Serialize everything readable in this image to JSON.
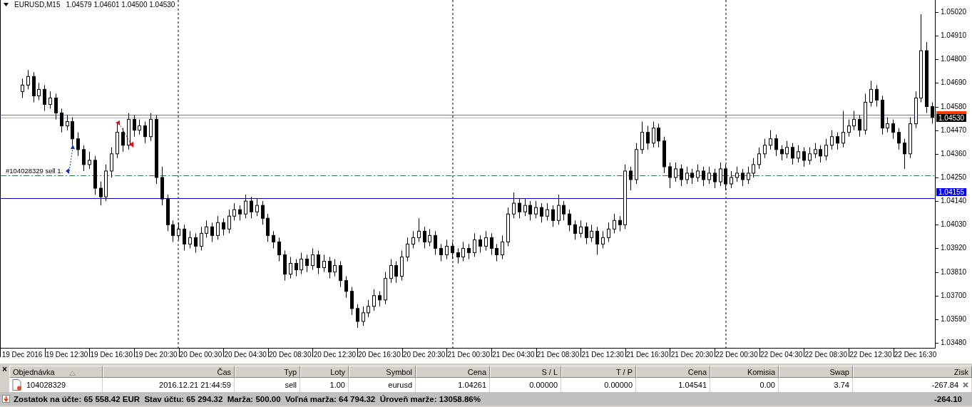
{
  "chart": {
    "symbol": "EURUSD,M15",
    "ohlc": "1.04579 1.04601 1.04500 1.04530",
    "order_label": "#104028329 sell 1.",
    "price_badges": [
      {
        "text": "1.04530",
        "color": "#000000"
      },
      {
        "text": "1.04155",
        "color": "#0000ff"
      }
    ],
    "chart_data": {
      "type": "candlestick",
      "categories": [
        "19 Dec 2016",
        null,
        null,
        null,
        null,
        null,
        null,
        null,
        "19 Dec 12:30",
        null,
        null,
        null,
        null,
        null,
        null,
        null,
        "19 Dec 16:30",
        null,
        null,
        null,
        null,
        null,
        null,
        null,
        "19 Dec 20:30",
        null,
        null,
        null,
        null,
        null,
        null,
        null,
        "20 Dec 00:30",
        null,
        null,
        null,
        null,
        null,
        null,
        null,
        "20 Dec 04:30",
        null,
        null,
        null,
        null,
        null,
        null,
        null,
        "20 Dec 08:30",
        null,
        null,
        null,
        null,
        null,
        null,
        null,
        "20 Dec 12:30",
        null,
        null,
        null,
        null,
        null,
        null,
        null,
        "20 Dec 16:30",
        null,
        null,
        null,
        null,
        null,
        null,
        null,
        "20 Dec 20:30",
        null,
        null,
        null,
        null,
        null,
        null,
        null,
        "21 Dec 00:30",
        null,
        null,
        null,
        null,
        null,
        null,
        null,
        "21 Dec 04:30",
        null,
        null,
        null,
        null,
        null,
        null,
        null,
        "21 Dec 08:30",
        null,
        null,
        null,
        null,
        null,
        null,
        null,
        "21 Dec 12:30",
        null,
        null,
        null,
        null,
        null,
        null,
        null,
        "21 Dec 16:30",
        null,
        null,
        null,
        null,
        null,
        null,
        null,
        "21 Dec 20:30",
        null,
        null,
        null,
        null,
        null,
        null,
        null,
        "22 Dec 00:30",
        null,
        null,
        null,
        null,
        null,
        null,
        null,
        "22 Dec 04:30",
        null,
        null,
        null,
        null,
        null,
        null,
        null,
        "22 Dec 08:30",
        null,
        null,
        null,
        null,
        null,
        null,
        null,
        "22 Dec 12:30",
        null,
        null,
        null,
        null,
        null,
        null,
        null,
        "22 Dec 16:30",
        null,
        null,
        null
      ],
      "ylim": [
        1.03457,
        1.05076
      ],
      "ref_lines": [
        {
          "axis": "y",
          "value": 1.04541,
          "color": "#e05a20"
        },
        {
          "axis": "y",
          "value": 1.0453,
          "color": "#b8b8b8"
        },
        {
          "axis": "y",
          "value": 1.04261,
          "color": "#2e7d32"
        },
        {
          "axis": "y",
          "value": 1.04155,
          "color": "#0000b0"
        }
      ],
      "ohlc": [
        [
          1.0465,
          1.0471,
          1.0462,
          1.0468
        ],
        [
          1.0468,
          1.0475,
          1.0466,
          1.0472
        ],
        [
          1.0472,
          1.0474,
          1.046,
          1.0463
        ],
        [
          1.0463,
          1.0469,
          1.0461,
          1.0466
        ],
        [
          1.0466,
          1.0468,
          1.0456,
          1.0459
        ],
        [
          1.0459,
          1.0465,
          1.0457,
          1.0462
        ],
        [
          1.0462,
          1.0464,
          1.0452,
          1.0455
        ],
        [
          1.0455,
          1.0457,
          1.0446,
          1.0449
        ],
        [
          1.0449,
          1.0454,
          1.0447,
          1.0451
        ],
        [
          1.0451,
          1.0453,
          1.044,
          1.0443
        ],
        [
          1.0443,
          1.0446,
          1.0435,
          1.0438
        ],
        [
          1.0438,
          1.044,
          1.0428,
          1.0431
        ],
        [
          1.0431,
          1.0437,
          1.0429,
          1.0433
        ],
        [
          1.0433,
          1.0435,
          1.0417,
          1.042
        ],
        [
          1.042,
          1.0423,
          1.0412,
          1.0416
        ],
        [
          1.0416,
          1.0431,
          1.0414,
          1.0428
        ],
        [
          1.0428,
          1.0439,
          1.0425,
          1.0436
        ],
        [
          1.0436,
          1.045,
          1.0434,
          1.0446
        ],
        [
          1.0446,
          1.0448,
          1.0437,
          1.044
        ],
        [
          1.044,
          1.0455,
          1.0438,
          1.0452
        ],
        [
          1.0452,
          1.0454,
          1.0444,
          1.0447
        ],
        [
          1.0447,
          1.0452,
          1.0445,
          1.0449
        ],
        [
          1.0449,
          1.0451,
          1.0441,
          1.0444
        ],
        [
          1.0444,
          1.0455,
          1.0442,
          1.0452
        ],
        [
          1.0452,
          1.0454,
          1.0422,
          1.0425
        ],
        [
          1.0425,
          1.043,
          1.0412,
          1.0415
        ],
        [
          1.0415,
          1.0417,
          1.04,
          1.0403
        ],
        [
          1.0403,
          1.0405,
          1.0395,
          1.0398
        ],
        [
          1.0398,
          1.0404,
          1.0396,
          1.0401
        ],
        [
          1.0401,
          1.0403,
          1.0391,
          1.0394
        ],
        [
          1.0394,
          1.04,
          1.0392,
          1.0397
        ],
        [
          1.0397,
          1.0399,
          1.039,
          1.0393
        ],
        [
          1.0393,
          1.0402,
          1.0391,
          1.0399
        ],
        [
          1.0399,
          1.0405,
          1.0397,
          1.0402
        ],
        [
          1.0402,
          1.0404,
          1.0395,
          1.0398
        ],
        [
          1.0398,
          1.0407,
          1.0396,
          1.0404
        ],
        [
          1.0404,
          1.0406,
          1.0398,
          1.0401
        ],
        [
          1.0401,
          1.041,
          1.0399,
          1.0407
        ],
        [
          1.0407,
          1.0413,
          1.0405,
          1.041
        ],
        [
          1.041,
          1.0412,
          1.0405,
          1.0408
        ],
        [
          1.0408,
          1.0417,
          1.0406,
          1.0414
        ],
        [
          1.0414,
          1.0416,
          1.0406,
          1.0409
        ],
        [
          1.0409,
          1.0415,
          1.0407,
          1.0412
        ],
        [
          1.0412,
          1.0414,
          1.0403,
          1.0406
        ],
        [
          1.0406,
          1.0408,
          1.0395,
          1.0398
        ],
        [
          1.0398,
          1.04,
          1.0392,
          1.0395
        ],
        [
          1.0395,
          1.0397,
          1.0386,
          1.0389
        ],
        [
          1.0389,
          1.0391,
          1.0377,
          1.038
        ],
        [
          1.038,
          1.0388,
          1.0378,
          1.0385
        ],
        [
          1.0385,
          1.0387,
          1.0379,
          1.0382
        ],
        [
          1.0382,
          1.039,
          1.038,
          1.0387
        ],
        [
          1.0387,
          1.0389,
          1.0381,
          1.0384
        ],
        [
          1.0384,
          1.0392,
          1.0382,
          1.0389
        ],
        [
          1.0389,
          1.0391,
          1.038,
          1.0383
        ],
        [
          1.0383,
          1.0389,
          1.0381,
          1.0386
        ],
        [
          1.0386,
          1.0388,
          1.0378,
          1.0381
        ],
        [
          1.0381,
          1.0387,
          1.0379,
          1.0384
        ],
        [
          1.0384,
          1.0386,
          1.0374,
          1.0377
        ],
        [
          1.0377,
          1.0379,
          1.0369,
          1.0372
        ],
        [
          1.0372,
          1.0374,
          1.0361,
          1.0364
        ],
        [
          1.0364,
          1.0366,
          1.0355,
          1.0358
        ],
        [
          1.0358,
          1.0365,
          1.0356,
          1.0362
        ],
        [
          1.0362,
          1.0368,
          1.036,
          1.0365
        ],
        [
          1.0365,
          1.0373,
          1.0363,
          1.037
        ],
        [
          1.037,
          1.0372,
          1.0365,
          1.0368
        ],
        [
          1.0368,
          1.0381,
          1.0366,
          1.0378
        ],
        [
          1.0378,
          1.0387,
          1.0376,
          1.0384
        ],
        [
          1.0384,
          1.0386,
          1.0376,
          1.0379
        ],
        [
          1.0379,
          1.0391,
          1.0377,
          1.0388
        ],
        [
          1.0388,
          1.0397,
          1.0386,
          1.0394
        ],
        [
          1.0394,
          1.04,
          1.0392,
          1.0397
        ],
        [
          1.0397,
          1.0406,
          1.0395,
          1.04
        ],
        [
          1.04,
          1.0402,
          1.0392,
          1.0395
        ],
        [
          1.0395,
          1.0401,
          1.0393,
          1.0398
        ],
        [
          1.0398,
          1.04,
          1.0389,
          1.0392
        ],
        [
          1.0392,
          1.0394,
          1.0386,
          1.0389
        ],
        [
          1.0389,
          1.0396,
          1.0387,
          1.0393
        ],
        [
          1.0393,
          1.0395,
          1.0387,
          1.039
        ],
        [
          1.039,
          1.0392,
          1.0385,
          1.0388
        ],
        [
          1.0388,
          1.0395,
          1.0386,
          1.0392
        ],
        [
          1.0392,
          1.0394,
          1.0387,
          1.039
        ],
        [
          1.039,
          1.0399,
          1.0388,
          1.0396
        ],
        [
          1.0396,
          1.0398,
          1.039,
          1.0393
        ],
        [
          1.0393,
          1.04,
          1.0391,
          1.0397
        ],
        [
          1.0397,
          1.0399,
          1.0389,
          1.0392
        ],
        [
          1.0392,
          1.0394,
          1.0386,
          1.0389
        ],
        [
          1.0389,
          1.0398,
          1.0387,
          1.0395
        ],
        [
          1.0395,
          1.0411,
          1.0393,
          1.0408
        ],
        [
          1.0408,
          1.0418,
          1.0406,
          1.0413
        ],
        [
          1.0413,
          1.0415,
          1.0406,
          1.0409
        ],
        [
          1.0409,
          1.0415,
          1.0407,
          1.0412
        ],
        [
          1.0412,
          1.0414,
          1.0405,
          1.0408
        ],
        [
          1.0408,
          1.0414,
          1.0406,
          1.0411
        ],
        [
          1.0411,
          1.0413,
          1.0404,
          1.0407
        ],
        [
          1.0407,
          1.0413,
          1.0405,
          1.041
        ],
        [
          1.041,
          1.0412,
          1.0402,
          1.0405
        ],
        [
          1.0405,
          1.0417,
          1.0403,
          1.0412
        ],
        [
          1.0412,
          1.0414,
          1.0405,
          1.0408
        ],
        [
          1.0408,
          1.041,
          1.04,
          1.0403
        ],
        [
          1.0403,
          1.0405,
          1.0396,
          1.0399
        ],
        [
          1.0399,
          1.0405,
          1.0397,
          1.0402
        ],
        [
          1.0402,
          1.0404,
          1.0394,
          1.0397
        ],
        [
          1.0397,
          1.0403,
          1.0395,
          1.04
        ],
        [
          1.04,
          1.0402,
          1.0389,
          1.0394
        ],
        [
          1.0394,
          1.04,
          1.0392,
          1.0397
        ],
        [
          1.0397,
          1.0404,
          1.0395,
          1.0401
        ],
        [
          1.0401,
          1.0408,
          1.0399,
          1.0405
        ],
        [
          1.0405,
          1.0407,
          1.04,
          1.0403
        ],
        [
          1.0403,
          1.0431,
          1.0401,
          1.0428
        ],
        [
          1.0428,
          1.043,
          1.0419,
          1.0424
        ],
        [
          1.0424,
          1.0441,
          1.0422,
          1.0438
        ],
        [
          1.0438,
          1.0451,
          1.0436,
          1.0446
        ],
        [
          1.0446,
          1.0449,
          1.0438,
          1.0441
        ],
        [
          1.0441,
          1.0451,
          1.0439,
          1.0448
        ],
        [
          1.0448,
          1.045,
          1.0439,
          1.0442
        ],
        [
          1.0442,
          1.0444,
          1.0427,
          1.043
        ],
        [
          1.043,
          1.0432,
          1.042,
          1.0425
        ],
        [
          1.0425,
          1.0432,
          1.0423,
          1.0429
        ],
        [
          1.0429,
          1.0431,
          1.0421,
          1.0424
        ],
        [
          1.0424,
          1.043,
          1.0422,
          1.0427
        ],
        [
          1.0427,
          1.0429,
          1.0422,
          1.0425
        ],
        [
          1.0425,
          1.0431,
          1.0423,
          1.0428
        ],
        [
          1.0428,
          1.043,
          1.0421,
          1.0424
        ],
        [
          1.0424,
          1.043,
          1.0422,
          1.0427
        ],
        [
          1.0427,
          1.0429,
          1.042,
          1.0423
        ],
        [
          1.0423,
          1.0432,
          1.0421,
          1.0429
        ],
        [
          1.0429,
          1.0431,
          1.0419,
          1.0422
        ],
        [
          1.0422,
          1.0428,
          1.042,
          1.0425
        ],
        [
          1.0425,
          1.043,
          1.0423,
          1.0427
        ],
        [
          1.0427,
          1.0429,
          1.0421,
          1.0424
        ],
        [
          1.0424,
          1.043,
          1.0422,
          1.0427
        ],
        [
          1.0427,
          1.0434,
          1.0425,
          1.0431
        ],
        [
          1.0431,
          1.0439,
          1.0429,
          1.0436
        ],
        [
          1.0436,
          1.0443,
          1.0434,
          1.044
        ],
        [
          1.044,
          1.0447,
          1.0438,
          1.0443
        ],
        [
          1.0443,
          1.0445,
          1.0435,
          1.0438
        ],
        [
          1.0438,
          1.044,
          1.0433,
          1.0436
        ],
        [
          1.0436,
          1.0442,
          1.0434,
          1.0439
        ],
        [
          1.0439,
          1.0441,
          1.0431,
          1.0434
        ],
        [
          1.0434,
          1.044,
          1.0432,
          1.0437
        ],
        [
          1.0437,
          1.0439,
          1.043,
          1.0433
        ],
        [
          1.0433,
          1.0439,
          1.0431,
          1.0436
        ],
        [
          1.0436,
          1.0441,
          1.0434,
          1.0438
        ],
        [
          1.0438,
          1.044,
          1.0432,
          1.0435
        ],
        [
          1.0435,
          1.0443,
          1.0433,
          1.044
        ],
        [
          1.044,
          1.0447,
          1.0438,
          1.0444
        ],
        [
          1.0444,
          1.0446,
          1.0438,
          1.0441
        ],
        [
          1.0441,
          1.0456,
          1.0439,
          1.0446
        ],
        [
          1.0446,
          1.0452,
          1.0444,
          1.0449
        ],
        [
          1.0449,
          1.0456,
          1.0447,
          1.0452
        ],
        [
          1.0452,
          1.0454,
          1.0444,
          1.0447
        ],
        [
          1.0447,
          1.0464,
          1.0445,
          1.046
        ],
        [
          1.046,
          1.047,
          1.0458,
          1.0466
        ],
        [
          1.0466,
          1.0468,
          1.0458,
          1.0461
        ],
        [
          1.0461,
          1.0463,
          1.0445,
          1.0448
        ],
        [
          1.0448,
          1.0453,
          1.0446,
          1.045
        ],
        [
          1.045,
          1.0452,
          1.0443,
          1.0446
        ],
        [
          1.0446,
          1.0448,
          1.0438,
          1.0441
        ],
        [
          1.0441,
          1.0443,
          1.0429,
          1.0436
        ],
        [
          1.0436,
          1.0453,
          1.0434,
          1.045
        ],
        [
          1.045,
          1.0465,
          1.0448,
          1.0462
        ],
        [
          1.0462,
          1.0501,
          1.046,
          1.0484
        ],
        [
          1.0484,
          1.0488,
          1.0455,
          1.0458
        ],
        [
          1.0458,
          1.046,
          1.045,
          1.0453
        ]
      ],
      "yticks": [
        {
          "value": 1.0502,
          "label": "1.05020"
        },
        {
          "value": 1.0491,
          "label": "1.04910"
        },
        {
          "value": 1.048,
          "label": "1.04800"
        },
        {
          "value": 1.0469,
          "label": "1.04690"
        },
        {
          "value": 1.0458,
          "label": "1.04580"
        },
        {
          "value": 1.0447,
          "label": "1.04470"
        },
        {
          "value": 1.0436,
          "label": "1.04360"
        },
        {
          "value": 1.0425,
          "label": "1.04250"
        },
        {
          "value": 1.0414,
          "label": "1.04140"
        },
        {
          "value": 1.0403,
          "label": "1.04030"
        },
        {
          "value": 1.0392,
          "label": "1.03920"
        },
        {
          "value": 1.0381,
          "label": "1.03810"
        },
        {
          "value": 1.037,
          "label": "1.03700"
        },
        {
          "value": 1.0359,
          "label": "1.03590"
        },
        {
          "value": 1.0348,
          "label": "1.03480"
        }
      ]
    }
  },
  "terminal": {
    "close": "×",
    "columns": [
      {
        "label": "Objednávka",
        "sorted": true
      },
      {
        "label": "Čas",
        "sorted": false
      },
      {
        "label": "Typ",
        "sorted": false
      },
      {
        "label": "Loty",
        "sorted": false
      },
      {
        "label": "Symbol",
        "sorted": false
      },
      {
        "label": "Cena",
        "sorted": false
      },
      {
        "label": "S / L",
        "sorted": false
      },
      {
        "label": "T / P",
        "sorted": false
      },
      {
        "label": "Cena",
        "sorted": false
      },
      {
        "label": "Komisia",
        "sorted": false
      },
      {
        "label": "Swap",
        "sorted": false
      },
      {
        "label": "Zisk",
        "sorted": false
      }
    ],
    "rows": [
      {
        "cells": [
          "104028329",
          "2016.12.21 21:44:59",
          "sell",
          "1.00",
          "eurusd",
          "1.04261",
          "0.00000",
          "0.00000",
          "1.04541",
          "0.00",
          "3.74",
          "-267.84"
        ]
      }
    ],
    "summary": {
      "text": "Zostatok na účte: 65 558.42 EUR  Stav účtu: 65 294.32  Marža: 500.00  Voľná marža: 64 794.32  Úroveň marže: 13058.86%",
      "total": "-264.10"
    }
  }
}
